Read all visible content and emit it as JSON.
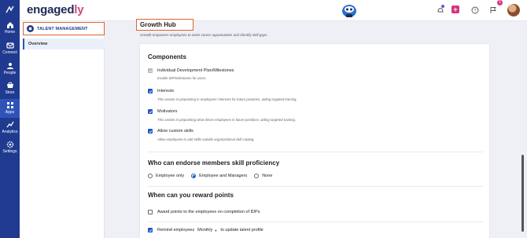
{
  "app": {
    "logo_main": "engaged",
    "logo_accent": "ly"
  },
  "header": {
    "notification_badge": "1"
  },
  "rail": {
    "items": [
      {
        "label": "Home",
        "icon": "home-icon"
      },
      {
        "label": "Connect",
        "icon": "connect-icon"
      },
      {
        "label": "People",
        "icon": "people-icon"
      },
      {
        "label": "Store",
        "icon": "store-icon"
      },
      {
        "label": "Apps",
        "icon": "apps-icon"
      },
      {
        "label": "Analytics",
        "icon": "analytics-icon"
      },
      {
        "label": "Settings",
        "icon": "settings-icon"
      }
    ]
  },
  "sidebar": {
    "title": "TALENT MANAGEMENT",
    "items": [
      {
        "label": "Overview"
      }
    ]
  },
  "page": {
    "title": "Growth Hub",
    "description": "Growth empowers employees to seize career opportunities and identify skill gaps."
  },
  "components": {
    "heading": "Components",
    "items": [
      {
        "label": "Individual Development Plan/Milestones",
        "desc": "Enable IDP/milestones for users.",
        "state": "disabled-checked"
      },
      {
        "label": "Interests",
        "desc": "This assists in pinpointing in employees' interests for future positions, aiding targeted training.",
        "state": "checked"
      },
      {
        "label": "Motivators",
        "desc": "This assists in pinpointing what drives employees in future positions, aiding targeted training.",
        "state": "checked"
      },
      {
        "label": "Allow custom skills",
        "desc": "Allow employees to add skills outside organizational skill catalog.",
        "state": "checked"
      }
    ]
  },
  "endorse": {
    "heading": "Who can endorse members skill proficiency",
    "options": [
      "Employee only",
      "Employee and Managers",
      "None"
    ],
    "selected": "Employee and Managers"
  },
  "reward": {
    "heading": "When can you reward points",
    "option1": "Award points to the employees on completion of IDPs",
    "remind_prefix": "Remind employees",
    "remind_frequency": "Monthly",
    "remind_suffix": "to update talent profile"
  },
  "colors": {
    "rail": "#1f3a8f",
    "accent": "#1f57c7",
    "highlight_box": "#e0622a",
    "pink": "#d63384"
  }
}
